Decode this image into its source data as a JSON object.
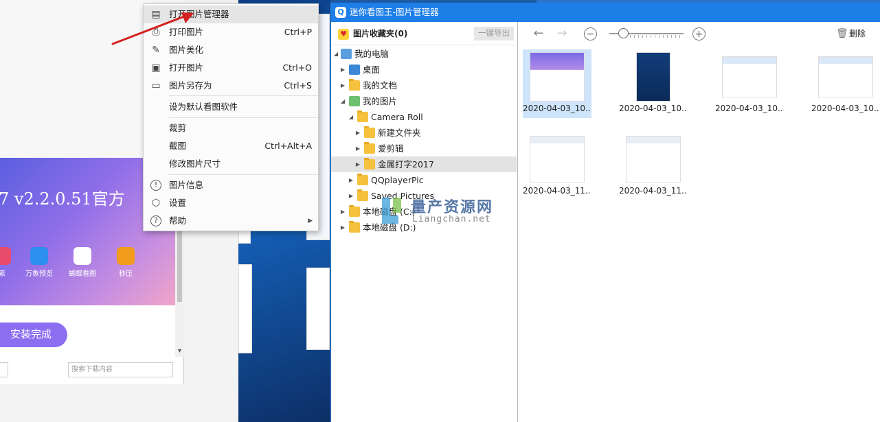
{
  "background_installer": {
    "banner_title": "7 v2.2.0.51官方",
    "apps": [
      "索",
      "万象预览",
      "蝴蝶看图",
      "秒压"
    ],
    "install_done_label": "安装完成",
    "search_placeholder": "搜索下载内容"
  },
  "context_menu": {
    "items": [
      {
        "label": "打开图片管理器",
        "shortcut": "",
        "icon": "folder-image-icon"
      },
      {
        "label": "打印图片",
        "shortcut": "Ctrl+P",
        "icon": "printer-icon"
      },
      {
        "label": "图片美化",
        "shortcut": "",
        "icon": "edit-pen-icon"
      },
      {
        "label": "打开图片",
        "shortcut": "Ctrl+O",
        "icon": "image-icon"
      },
      {
        "label": "图片另存为",
        "shortcut": "Ctrl+S",
        "icon": "save-icon"
      },
      {
        "label": "设为默认看图软件",
        "shortcut": ""
      },
      {
        "label": "裁剪",
        "shortcut": ""
      },
      {
        "label": "截图",
        "shortcut": "Ctrl+Alt+A"
      },
      {
        "label": "修改图片尺寸",
        "shortcut": ""
      },
      {
        "label": "图片信息",
        "shortcut": "",
        "icon": "info-icon"
      },
      {
        "label": "设置",
        "shortcut": "",
        "icon": "settings-icon"
      },
      {
        "label": "帮助",
        "shortcut": "",
        "icon": "help-icon"
      }
    ]
  },
  "picture_manager": {
    "title": "迷你看图王-图片管理器",
    "favorites_label": "图片收藏夹(0)",
    "export_label": "一键导出",
    "delete_label": "删除",
    "tree": [
      {
        "label": "我的电脑"
      },
      {
        "label": "桌面"
      },
      {
        "label": "我的文档"
      },
      {
        "label": "我的图片"
      },
      {
        "label": "Camera Roll"
      },
      {
        "label": "新建文件夹"
      },
      {
        "label": "爱剪辑"
      },
      {
        "label": "金属打字2017"
      },
      {
        "label": "QQplayerPic"
      },
      {
        "label": "Saved Pictures"
      },
      {
        "label": "本地磁盘 (C:)"
      },
      {
        "label": "本地磁盘 (D:)"
      }
    ],
    "thumbnails": [
      {
        "caption": "2020-04-03_10..."
      },
      {
        "caption": "2020-04-03_10..."
      },
      {
        "caption": "2020-04-03_10..."
      },
      {
        "caption": "2020-04-03_10..."
      },
      {
        "caption": "2020-04-03_11..."
      },
      {
        "caption": "2020-04-03_11..."
      }
    ]
  },
  "watermark": {
    "main": "量产资源网",
    "sub": "Liangchan.net"
  },
  "colors": {
    "title_bar": "#1e7ee8",
    "selection": "#cde4fb",
    "arrow": "#d42020",
    "install_button": "#8b6ff0"
  }
}
